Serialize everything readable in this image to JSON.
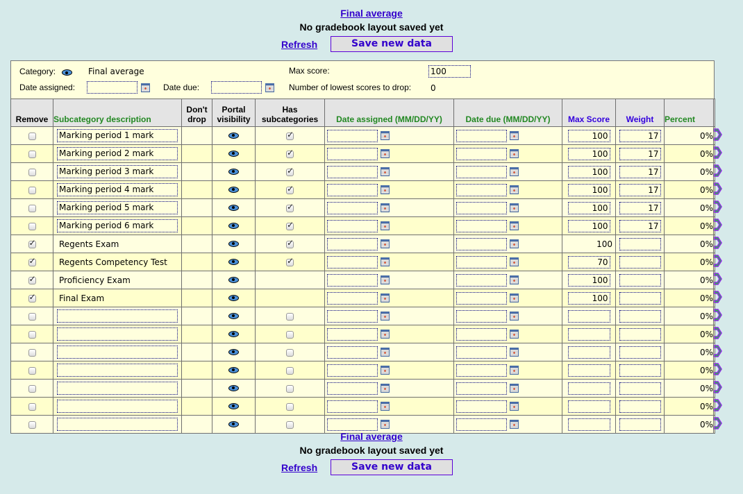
{
  "header": {
    "title_link": "Final average",
    "status": "No gradebook layout saved yet",
    "refresh_label": "Refresh",
    "save_label": "Save new data"
  },
  "category_panel": {
    "category_label": "Category:",
    "category_value": "Final average",
    "date_assigned_label": "Date assigned:",
    "date_assigned_value": "",
    "date_due_label": "Date due:",
    "date_due_value": "",
    "max_score_label": "Max score:",
    "max_score_value": "100",
    "lowest_drop_label": "Number of lowest scores to drop:",
    "lowest_drop_value": "0"
  },
  "table": {
    "headers": {
      "remove": "Remove",
      "description": "Subcategory description",
      "dont_drop": "Don't drop",
      "portal_visibility": "Portal visibility",
      "has_subcategories": "Has subcategories",
      "date_assigned": "Date assigned (MM/DD/YY)",
      "date_due": "Date due (MM/DD/YY)",
      "max_score": "Max Score",
      "weight": "Weight",
      "percent": "Percent"
    },
    "rows": [
      {
        "remove": false,
        "description": "Marking period 1 mark",
        "desc_editable": true,
        "has_sub": true,
        "max_score": "100",
        "max_editable": true,
        "weight": "17",
        "percent": "0%"
      },
      {
        "remove": false,
        "description": "Marking period 2 mark",
        "desc_editable": true,
        "has_sub": true,
        "max_score": "100",
        "max_editable": true,
        "weight": "17",
        "percent": "0%"
      },
      {
        "remove": false,
        "description": "Marking period 3 mark",
        "desc_editable": true,
        "has_sub": true,
        "max_score": "100",
        "max_editable": true,
        "weight": "17",
        "percent": "0%"
      },
      {
        "remove": false,
        "description": "Marking period 4 mark",
        "desc_editable": true,
        "has_sub": true,
        "max_score": "100",
        "max_editable": true,
        "weight": "17",
        "percent": "0%"
      },
      {
        "remove": false,
        "description": "Marking period 5 mark",
        "desc_editable": true,
        "has_sub": true,
        "max_score": "100",
        "max_editable": true,
        "weight": "17",
        "percent": "0%"
      },
      {
        "remove": false,
        "description": "Marking period 6 mark",
        "desc_editable": true,
        "has_sub": true,
        "max_score": "100",
        "max_editable": true,
        "weight": "17",
        "percent": "0%"
      },
      {
        "remove": true,
        "description": "Regents Exam",
        "desc_editable": false,
        "has_sub": true,
        "max_score": "100",
        "max_editable": false,
        "weight": "",
        "percent": "0%"
      },
      {
        "remove": true,
        "description": "Regents Competency Test",
        "desc_editable": false,
        "has_sub": true,
        "max_score": "70",
        "max_editable": true,
        "weight": "",
        "percent": "0%"
      },
      {
        "remove": true,
        "description": "Proficiency Exam",
        "desc_editable": false,
        "has_sub": null,
        "max_score": "100",
        "max_editable": true,
        "weight": "",
        "percent": "0%"
      },
      {
        "remove": true,
        "description": "Final Exam",
        "desc_editable": false,
        "has_sub": null,
        "max_score": "100",
        "max_editable": true,
        "weight": "",
        "percent": "0%"
      },
      {
        "remove": false,
        "description": "",
        "desc_editable": true,
        "has_sub": false,
        "max_score": "",
        "max_editable": true,
        "weight": "",
        "percent": "0%"
      },
      {
        "remove": false,
        "description": "",
        "desc_editable": true,
        "has_sub": false,
        "max_score": "",
        "max_editable": true,
        "weight": "",
        "percent": "0%"
      },
      {
        "remove": false,
        "description": "",
        "desc_editable": true,
        "has_sub": false,
        "max_score": "",
        "max_editable": true,
        "weight": "",
        "percent": "0%"
      },
      {
        "remove": false,
        "description": "",
        "desc_editable": true,
        "has_sub": false,
        "max_score": "",
        "max_editable": true,
        "weight": "",
        "percent": "0%"
      },
      {
        "remove": false,
        "description": "",
        "desc_editable": true,
        "has_sub": false,
        "max_score": "",
        "max_editable": true,
        "weight": "",
        "percent": "0%"
      },
      {
        "remove": false,
        "description": "",
        "desc_editable": true,
        "has_sub": false,
        "max_score": "",
        "max_editable": true,
        "weight": "",
        "percent": "0%"
      },
      {
        "remove": false,
        "description": "",
        "desc_editable": true,
        "has_sub": false,
        "max_score": "",
        "max_editable": true,
        "weight": "",
        "percent": "0%"
      }
    ]
  },
  "footer": {
    "title_link": "Final average",
    "status": "No gradebook layout saved yet",
    "refresh_label": "Refresh",
    "save_label": "Save new data"
  },
  "colors": {
    "page_bg": "#d6eaea",
    "panel_bg": "#ffffdd",
    "link": "#3300cc",
    "header_green": "#228822",
    "header_blue": "#3300dd"
  }
}
